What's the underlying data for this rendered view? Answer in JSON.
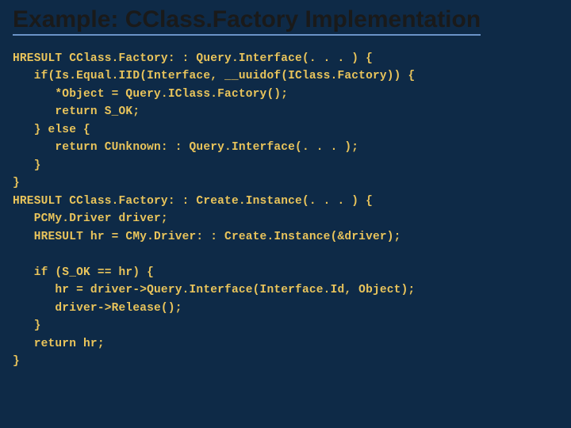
{
  "slide": {
    "title": "Example: CClass.Factory Implementation",
    "code": "HRESULT CClass.Factory: : Query.Interface(. . . ) {\n   if(Is.Equal.IID(Interface, __uuidof(IClass.Factory)) {\n      *Object = Query.IClass.Factory();\n      return S_OK;\n   } else {\n      return CUnknown: : Query.Interface(. . . );\n   }\n}\nHRESULT CClass.Factory: : Create.Instance(. . . ) {\n   PCMy.Driver driver;\n   HRESULT hr = CMy.Driver: : Create.Instance(&driver);\n\n   if (S_OK == hr) {\n      hr = driver->Query.Interface(Interface.Id, Object);\n      driver->Release();\n   }\n   return hr;\n}"
  },
  "colors": {
    "background": "#0e2a47",
    "title_text": "#1a1a1a",
    "title_underline": "#6b93c7",
    "code_text": "#e9c45b"
  }
}
